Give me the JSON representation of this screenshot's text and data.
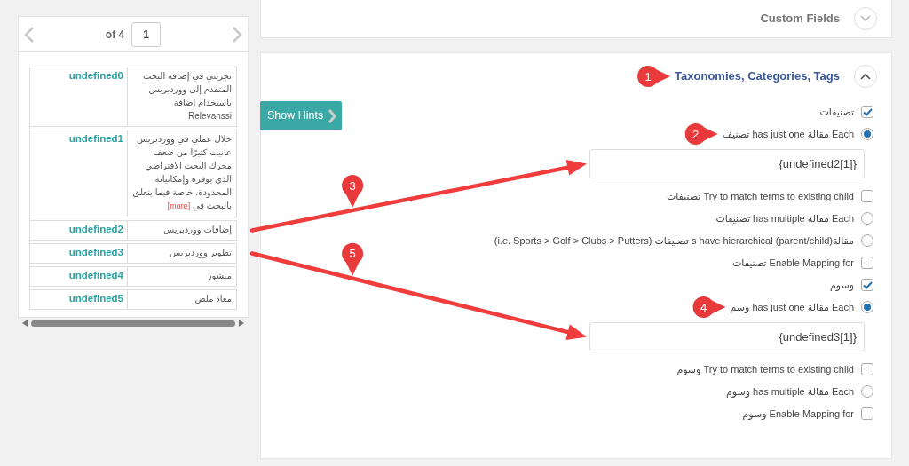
{
  "preview_panel": {
    "pager": {
      "of": "of 4",
      "page": "1"
    },
    "rows": [
      {
        "key": "undefined0",
        "text": "تجربتي في إضافة البحث المتقدم إلى ووردبريس باستخدام إضافة Relevanssi"
      },
      {
        "key": "undefined1",
        "text": "خلال عملي في ووردبريس عانيت كثيرًا من ضعف محرك البحث الافتراضي الذي يوفره وإمكانياته المحدودة، خاصة فيما يتعلق بالبحث في",
        "more": "[more]"
      },
      {
        "key": "undefined2",
        "text": "إضافات ووردبريس"
      },
      {
        "key": "undefined3",
        "text": "تطوير ووردبريس"
      },
      {
        "key": "undefined4",
        "text": "منشور"
      },
      {
        "key": "undefined5",
        "text": "معاذ ملص"
      }
    ]
  },
  "show_hints": "Show Hints",
  "sections": [
    {
      "title": "Custom Fields",
      "expanded": false
    },
    {
      "title": "Taxonomies, Categories, Tags",
      "expanded": true,
      "groups": [
        {
          "items": [
            {
              "kind": "checkbox",
              "label": "تصنيفات",
              "checked": true
            },
            {
              "kind": "radio",
              "label": "Each مقالة has just one تصنيف",
              "selected": true
            },
            {
              "kind": "field",
              "value": "{undefined2[1]}"
            },
            {
              "kind": "checkbox",
              "label": "Try to match terms to existing child تصنيفات",
              "checked": false
            },
            {
              "kind": "radio",
              "label": "Each مقالة has multiple تصنيفات",
              "selected": false
            },
            {
              "kind": "radio",
              "label": "مقالةs have hierarchical (parent/child) تصنيفات (i.e. Sports > Golf > Clubs > Putters)",
              "selected": false
            },
            {
              "kind": "checkbox",
              "label": "Enable Mapping for تصنيفات",
              "checked": false
            }
          ]
        },
        {
          "items": [
            {
              "kind": "checkbox",
              "label": "وسوم",
              "checked": true
            },
            {
              "kind": "radio",
              "label": "Each مقالة has just one وسم",
              "selected": true
            },
            {
              "kind": "field",
              "value": "{undefined3[1]}"
            },
            {
              "kind": "checkbox",
              "label": "Try to match terms to existing child وسوم",
              "checked": false
            },
            {
              "kind": "radio",
              "label": "Each مقالة has multiple وسوم",
              "selected": false
            },
            {
              "kind": "checkbox",
              "label": "Enable Mapping for وسوم",
              "checked": false
            }
          ]
        }
      ]
    }
  ],
  "annotations": [
    {
      "label": "1"
    },
    {
      "label": "2"
    },
    {
      "label": "3"
    },
    {
      "label": "4"
    },
    {
      "label": "5"
    }
  ]
}
